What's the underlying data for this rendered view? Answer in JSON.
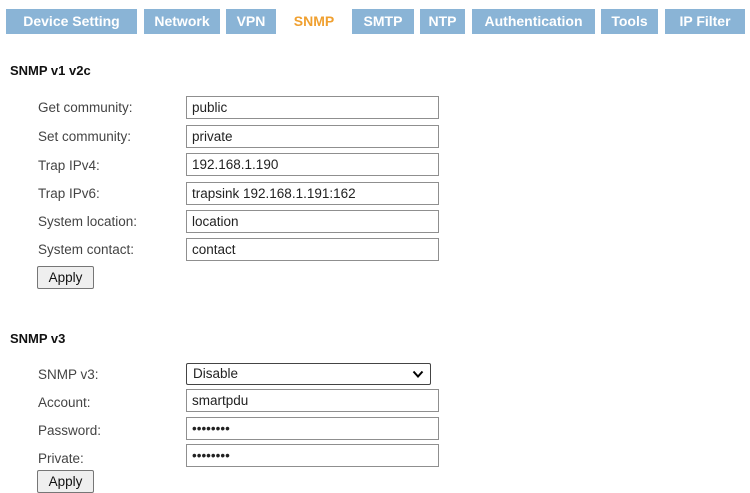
{
  "tabs": [
    {
      "label": "Device Setting",
      "active": false
    },
    {
      "label": "Network",
      "active": false
    },
    {
      "label": "VPN",
      "active": false
    },
    {
      "label": "SNMP",
      "active": true
    },
    {
      "label": "SMTP",
      "active": false
    },
    {
      "label": "NTP",
      "active": false
    },
    {
      "label": "Authentication",
      "active": false
    },
    {
      "label": "Tools",
      "active": false
    },
    {
      "label": "IP Filter",
      "active": false
    }
  ],
  "snmp_v1v2c": {
    "title": "SNMP v1 v2c",
    "get_community": {
      "label": "Get community:",
      "value": "public"
    },
    "set_community": {
      "label": "Set community:",
      "value": "private"
    },
    "trap_ipv4": {
      "label": "Trap IPv4:",
      "value": "192.168.1.190"
    },
    "trap_ipv6": {
      "label": "Trap IPv6:",
      "value": "trapsink 192.168.1.191:162"
    },
    "system_location": {
      "label": "System location:",
      "value": "location"
    },
    "system_contact": {
      "label": "System contact:",
      "value": "contact"
    },
    "apply_label": "Apply"
  },
  "snmp_v3": {
    "title": "SNMP v3",
    "snmp_v3": {
      "label": "SNMP v3:",
      "selected": "Disable"
    },
    "account": {
      "label": "Account:",
      "value": "smartpdu"
    },
    "password": {
      "label": "Password:",
      "value": "password"
    },
    "private": {
      "label": "Private:",
      "value": "password"
    },
    "apply_label": "Apply"
  },
  "colors": {
    "tab_bg": "#8ab4d6",
    "tab_text": "#ffffff",
    "active_tab_text": "#f0a030"
  }
}
